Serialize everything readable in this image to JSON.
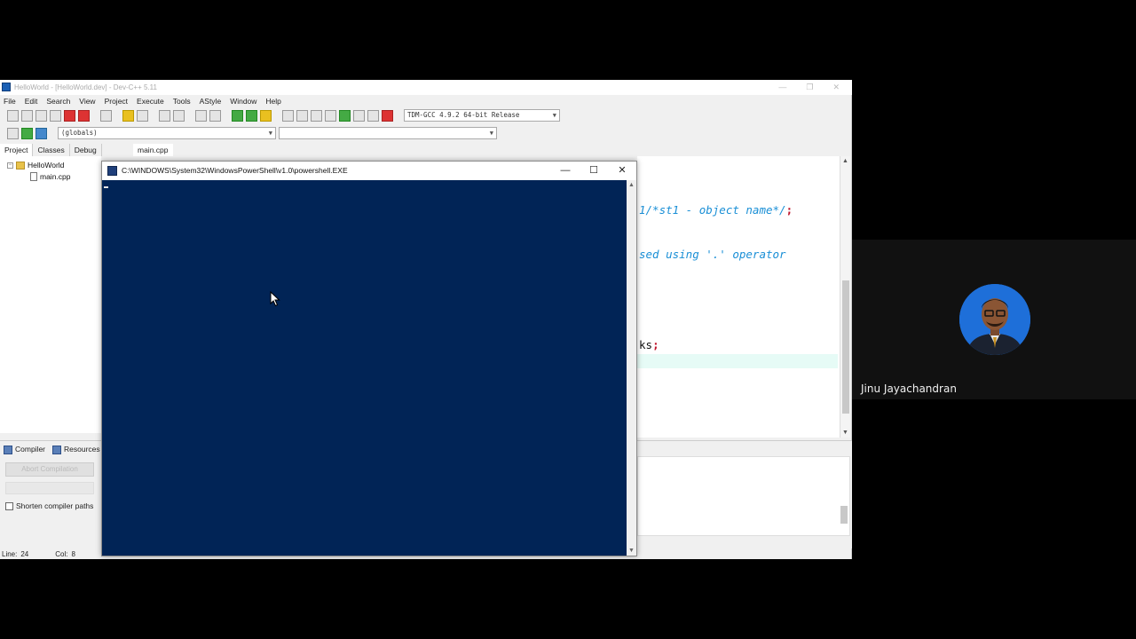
{
  "ide": {
    "title": "HelloWorld - [HelloWorld.dev] - Dev-C++ 5.11",
    "window_controls": [
      "—",
      "❐",
      "✕"
    ],
    "menu": [
      "File",
      "Edit",
      "Search",
      "View",
      "Project",
      "Execute",
      "Tools",
      "AStyle",
      "Window",
      "Help"
    ],
    "compiler_select": "TDM-GCC 4.9.2 64-bit Release",
    "scope_select": "(globals)",
    "side_tabs": [
      "Project",
      "Classes",
      "Debug"
    ],
    "file_tab": "main.cpp",
    "tree": {
      "project": "HelloWorld",
      "file": "main.cpp"
    },
    "code_lines": [
      {
        "text": "1/*st1 - object name*/",
        "punct": ";"
      },
      {
        "text": "sed using '.' operator",
        "punct": ""
      },
      {
        "text": "ks",
        "punct": ";"
      }
    ],
    "bottom_tabs": [
      "Compiler",
      "Resources"
    ],
    "abort_label": "Abort Compilation",
    "shorten_label": "Shorten compiler paths",
    "status": {
      "line": "Line:",
      "line_val": "24",
      "col": "Col:",
      "col_val": "8"
    }
  },
  "powershell": {
    "title": "C:\\WINDOWS\\System32\\WindowsPowerShell\\v1.0\\powershell.EXE",
    "minimize": "—",
    "maximize": "☐",
    "close": "✕",
    "bg_color": "#012456"
  },
  "participant": {
    "name": "Jinu Jayachandran"
  }
}
